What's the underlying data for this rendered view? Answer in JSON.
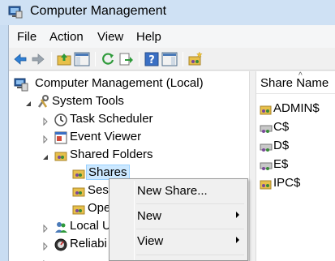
{
  "window": {
    "title": "Computer Management"
  },
  "menubar": {
    "items": [
      "File",
      "Action",
      "View",
      "Help"
    ]
  },
  "toolbar": {
    "buttons": [
      "back-icon",
      "forward-icon",
      "up-folder-icon",
      "show-hide-tree-icon",
      "refresh-icon",
      "export-list-icon",
      "help-icon",
      "show-hide-action-pane-icon",
      "shared-folder-icon"
    ]
  },
  "tree": {
    "root": "Computer Management (Local)",
    "system_tools": "System Tools",
    "task_scheduler": "Task Scheduler",
    "event_viewer": "Event Viewer",
    "shared_folders": "Shared Folders",
    "shares": "Shares",
    "sessions": "Ses",
    "open_files": "Ope",
    "local_users": "Local U",
    "reliability": "Reliabi"
  },
  "list": {
    "column_header": "Share Name",
    "shares": [
      "ADMIN$",
      "C$",
      "D$",
      "E$",
      "IPC$"
    ]
  },
  "context_menu": {
    "new_share": "New Share...",
    "new": "New",
    "view": "View"
  },
  "colors": {
    "title_bar": "#cfe1f4",
    "selection": "#cce8ff",
    "selection_border": "#99d1ff"
  }
}
